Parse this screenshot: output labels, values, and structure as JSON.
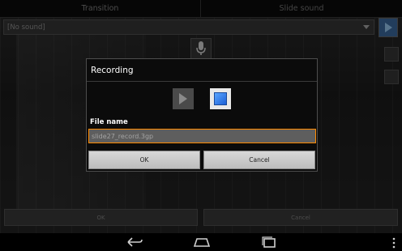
{
  "tabs": [
    {
      "label": "Transition"
    },
    {
      "label": "Slide sound"
    }
  ],
  "sound_select": {
    "value": "[No sound]"
  },
  "dialog": {
    "title": "Recording",
    "file_name_label": "File name",
    "file_name_value": "slide27_record.3gp",
    "ok_label": "OK",
    "cancel_label": "Cancel"
  },
  "bottom": {
    "ok_label": "OK",
    "cancel_label": "Cancel"
  },
  "colors": {
    "accent_input_border": "#ff8a00",
    "play_side_button": "#3f6fa8",
    "stop_icon": "#1c5fd6"
  },
  "icons": {
    "mic": "microphone-icon",
    "play": "play-icon",
    "stop": "stop-icon",
    "back": "back-icon",
    "home": "home-icon",
    "recent": "recent-apps-icon",
    "menu": "overflow-menu-icon"
  }
}
